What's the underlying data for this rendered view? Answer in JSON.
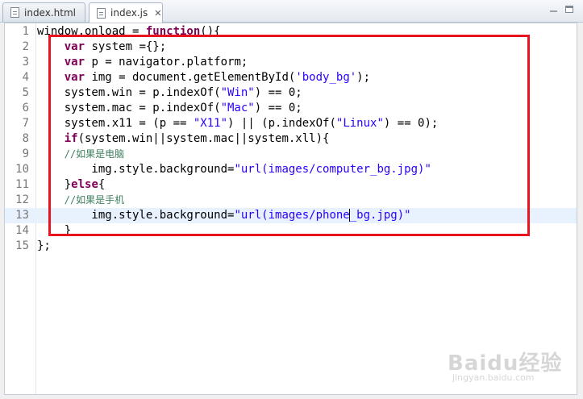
{
  "tabs": [
    {
      "label": "index.html",
      "active": false
    },
    {
      "label": "index.js",
      "active": true,
      "close": "✕"
    }
  ],
  "editor": {
    "current_line": 13,
    "lines": [
      {
        "num": "1",
        "tokens": [
          [
            "t",
            "window.onload = "
          ],
          [
            "kw",
            "function"
          ],
          [
            "t",
            "(){"
          ]
        ]
      },
      {
        "num": "2",
        "tokens": [
          [
            "t",
            "    "
          ],
          [
            "kw",
            "var"
          ],
          [
            "t",
            " system ={};"
          ]
        ]
      },
      {
        "num": "3",
        "tokens": [
          [
            "t",
            "    "
          ],
          [
            "kw",
            "var"
          ],
          [
            "t",
            " p = navigator.platform;"
          ]
        ]
      },
      {
        "num": "4",
        "tokens": [
          [
            "t",
            "    "
          ],
          [
            "kw",
            "var"
          ],
          [
            "t",
            " img = document.getElementById("
          ],
          [
            "str",
            "'body_bg'"
          ],
          [
            "t",
            ");"
          ]
        ]
      },
      {
        "num": "5",
        "tokens": [
          [
            "t",
            "    system.win = p.indexOf("
          ],
          [
            "str",
            "\"Win\""
          ],
          [
            "t",
            ") == 0;"
          ]
        ]
      },
      {
        "num": "6",
        "tokens": [
          [
            "t",
            "    system.mac = p.indexOf("
          ],
          [
            "str",
            "\"Mac\""
          ],
          [
            "t",
            ") == 0;"
          ]
        ]
      },
      {
        "num": "7",
        "tokens": [
          [
            "t",
            "    system.x11 = (p == "
          ],
          [
            "str",
            "\"X11\""
          ],
          [
            "t",
            ") || (p.indexOf("
          ],
          [
            "str",
            "\"Linux\""
          ],
          [
            "t",
            ") == 0);"
          ]
        ]
      },
      {
        "num": "8",
        "tokens": [
          [
            "t",
            "    "
          ],
          [
            "kw",
            "if"
          ],
          [
            "t",
            "(system.win||system.mac||system.xll){"
          ]
        ]
      },
      {
        "num": "9",
        "tokens": [
          [
            "t",
            "    "
          ],
          [
            "cm",
            "//如果是电脑"
          ]
        ]
      },
      {
        "num": "10",
        "tokens": [
          [
            "t",
            "        img.style.background="
          ],
          [
            "str",
            "\"url(images/computer_bg.jpg)\""
          ]
        ]
      },
      {
        "num": "11",
        "tokens": [
          [
            "t",
            "    }"
          ],
          [
            "kw",
            "else"
          ],
          [
            "t",
            "{"
          ]
        ]
      },
      {
        "num": "12",
        "tokens": [
          [
            "t",
            "    "
          ],
          [
            "cm",
            "//如果是手机"
          ]
        ]
      },
      {
        "num": "13",
        "tokens": [
          [
            "t",
            "        img.style.background="
          ],
          [
            "str",
            "\"url(images/phone"
          ],
          [
            "caret",
            ""
          ],
          [
            "str",
            "_bg.jpg)\""
          ]
        ]
      },
      {
        "num": "14",
        "tokens": [
          [
            "t",
            "    }"
          ]
        ]
      },
      {
        "num": "15",
        "tokens": [
          [
            "t",
            "};"
          ]
        ]
      }
    ]
  },
  "watermark": {
    "main": "Baidu经验",
    "sub": "jingyan.baidu.com"
  }
}
